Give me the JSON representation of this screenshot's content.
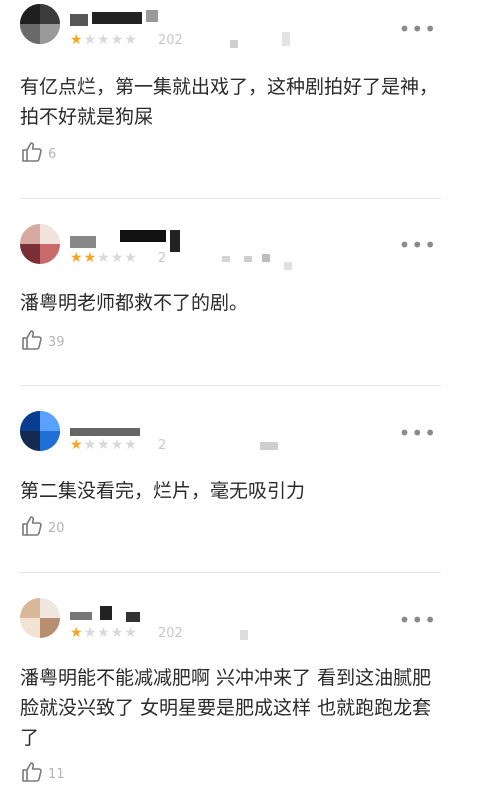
{
  "reviews": [
    {
      "user_name": "",
      "rating": 1,
      "max_rating": 5,
      "date": "202",
      "content": "有亿点烂，第一集就出戏了，这种剧拍好了是神，拍不好就是狗屎",
      "likes": "6",
      "avatar_colors": [
        "#2b2b2b",
        "#5a5a5a",
        "#8c8c8c",
        "#bdbdbd"
      ]
    },
    {
      "user_name": "",
      "rating": 2,
      "max_rating": 5,
      "date": "2",
      "content": "潘粤明老师都救不了的剧。",
      "likes": "39",
      "avatar_colors": [
        "#c96a6a",
        "#7a2f36",
        "#e8c8c0",
        "#f3e3dd"
      ]
    },
    {
      "user_name": "",
      "rating": 1,
      "max_rating": 5,
      "date": "2",
      "content": "第二集没看完，烂片，毫无吸引力",
      "likes": "20",
      "avatar_colors": [
        "#1f6fd6",
        "#0a3d8f",
        "#5aa0ff",
        "#142a4f"
      ]
    },
    {
      "user_name": "",
      "rating": 1,
      "max_rating": 5,
      "date": "202",
      "content": "潘粤明能不能减减肥啊  兴冲冲来了  看到这油腻肥脸就没兴致了  女明星要是肥成这样  也就跑跑龙套了",
      "likes": "11",
      "avatar_colors": [
        "#d9b89a",
        "#f2e2d3",
        "#b58f6f",
        "#efe6de"
      ]
    }
  ],
  "icons": {
    "more": "more-dots-icon",
    "like": "thumbs-up-icon",
    "star_filled": "star-filled-icon",
    "star_empty": "star-empty-icon"
  },
  "colors": {
    "star_on": "#f5a623",
    "star_off": "#d9d9d9",
    "text": "#2a2a2a",
    "meta": "#b5b5b5"
  }
}
